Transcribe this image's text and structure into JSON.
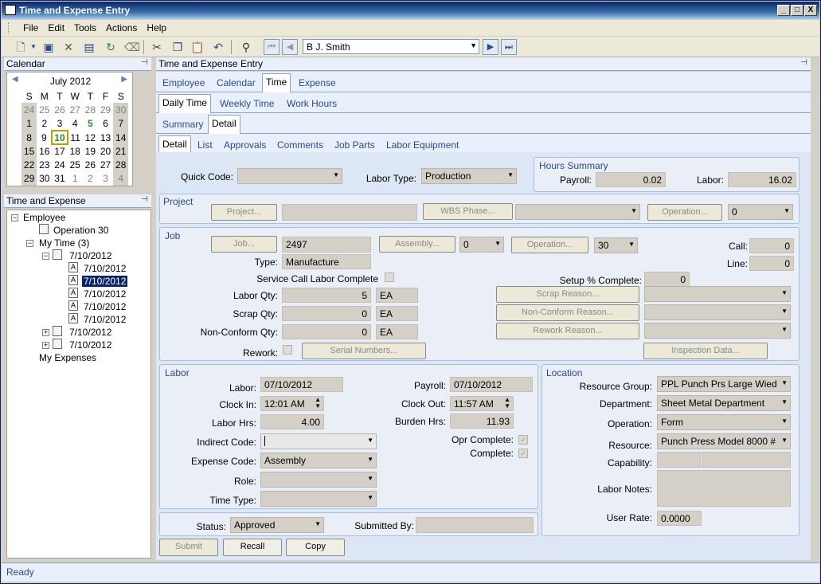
{
  "window": {
    "title": "Time and Expense Entry",
    "buttons": [
      "_",
      "□",
      "X"
    ]
  },
  "menu": [
    "File",
    "Edit",
    "Tools",
    "Actions",
    "Help"
  ],
  "toolbar": {
    "employee": "B J. Smith"
  },
  "calendar": {
    "header": "Calendar",
    "month": "July 2012",
    "dow": [
      "S",
      "M",
      "T",
      "W",
      "T",
      "F",
      "S"
    ],
    "weeks": [
      [
        "24",
        "25",
        "26",
        "27",
        "28",
        "29",
        "30"
      ],
      [
        "1",
        "2",
        "3",
        "4",
        "5",
        "6",
        "7"
      ],
      [
        "8",
        "9",
        "10",
        "11",
        "12",
        "13",
        "14"
      ],
      [
        "15",
        "16",
        "17",
        "18",
        "19",
        "20",
        "21"
      ],
      [
        "22",
        "23",
        "24",
        "25",
        "26",
        "27",
        "28"
      ],
      [
        "29",
        "30",
        "31",
        "1",
        "2",
        "3",
        "4"
      ]
    ]
  },
  "tree": {
    "header": "Time and Expense",
    "nodes": {
      "employee": "Employee",
      "operation": "Operation 30",
      "mytime": "My Time (3)",
      "d1": "7/10/2012",
      "d1a": "7/10/2012",
      "d1b": "7/10/2012",
      "d1c": "7/10/2012",
      "d1d": "7/10/2012",
      "d1e": "7/10/2012",
      "d2": "7/10/2012",
      "d3": "7/10/2012",
      "myexpenses": "My Expenses"
    }
  },
  "main": {
    "title": "Time and Expense Entry",
    "tabs1": [
      "Employee",
      "Calendar",
      "Time",
      "Expense"
    ],
    "tabs2": [
      "Daily Time",
      "Weekly Time",
      "Work Hours"
    ],
    "tabs3": [
      "Summary",
      "Detail"
    ],
    "tabs4": [
      "Detail",
      "List",
      "Approvals",
      "Comments",
      "Job Parts",
      "Labor Equipment"
    ]
  },
  "form": {
    "quick_code_label": "Quick Code:",
    "labor_type_label": "Labor Type:",
    "labor_type": "Production",
    "hours_summary": {
      "title": "Hours Summary",
      "payroll_label": "Payroll:",
      "payroll": "0.02",
      "labor_label": "Labor:",
      "labor": "16.02"
    },
    "project": {
      "title": "Project",
      "project_btn": "Project...",
      "wbs_btn": "WBS Phase...",
      "operation_btn": "Operation...",
      "operation_val": "0"
    },
    "job": {
      "title": "Job",
      "job_btn": "Job...",
      "job": "2497",
      "assembly_btn": "Assembly...",
      "assembly": "0",
      "operation_btn": "Operation...",
      "operation": "30",
      "call_label": "Call:",
      "call": "0",
      "line_label": "Line:",
      "line": "0",
      "type_label": "Type:",
      "type": "Manufacture",
      "service_label": "Service Call Labor Complete",
      "setup_label": "Setup % Complete:",
      "setup": "0",
      "labor_qty_label": "Labor Qty:",
      "labor_qty": "5",
      "labor_uom": "EA",
      "scrap_qty_label": "Scrap Qty:",
      "scrap_qty": "0",
      "scrap_uom": "EA",
      "nc_qty_label": "Non-Conform Qty:",
      "nc_qty": "0",
      "nc_uom": "EA",
      "scrap_reason_btn": "Scrap Reason...",
      "nc_reason_btn": "Non-Conform Reason...",
      "rework_reason_btn": "Rework Reason...",
      "rework_label": "Rework:",
      "serial_btn": "Serial Numbers...",
      "inspection_btn": "Inspection Data..."
    },
    "labor": {
      "title": "Labor",
      "labor_label": "Labor:",
      "labor_date": "07/10/2012",
      "payroll_label": "Payroll:",
      "payroll_date": "07/10/2012",
      "clockin_label": "Clock In:",
      "clockin": "12:01 AM",
      "clockout_label": "Clock Out:",
      "clockout": "11:57 AM",
      "laborhrs_label": "Labor Hrs:",
      "laborhrs": "4.00",
      "burden_label": "Burden Hrs:",
      "burden": "11.93",
      "indirect_label": "Indirect Code:",
      "opr_complete_label": "Opr Complete:",
      "complete_label": "Complete:",
      "expense_label": "Expense Code:",
      "expense": "Assembly",
      "role_label": "Role:",
      "timetype_label": "Time Type:"
    },
    "location": {
      "title": "Location",
      "rg_label": "Resource Group:",
      "rg": "PPL Punch Prs Large Wied",
      "dept_label": "Department:",
      "dept": "Sheet Metal Department",
      "op_label": "Operation:",
      "op": "Form",
      "res_label": "Resource:",
      "res": "Punch Press Model 8000 #",
      "cap_label": "Capability:",
      "notes_label": "Labor Notes:",
      "rate_label": "User Rate:",
      "rate": "0.0000"
    },
    "status": {
      "label": "Status:",
      "value": "Approved",
      "submitted_label": "Submitted By:"
    },
    "buttons": {
      "submit": "Submit",
      "recall": "Recall",
      "copy": "Copy"
    }
  },
  "statusbar": "Ready"
}
